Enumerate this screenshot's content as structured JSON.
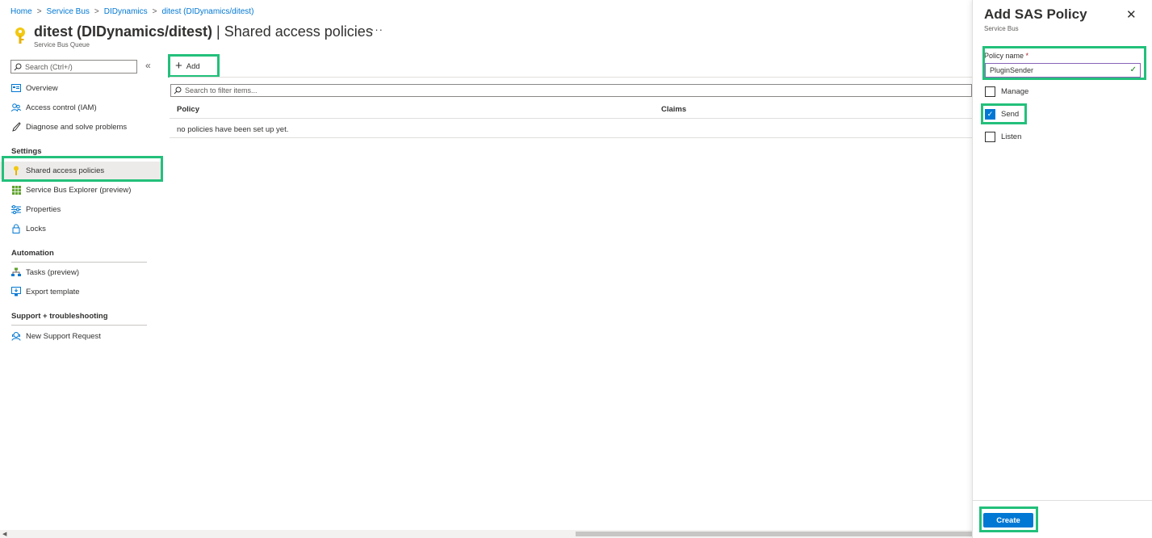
{
  "breadcrumb": {
    "items": [
      "Home",
      "Service Bus",
      "DIDynamics",
      "ditest (DIDynamics/ditest)"
    ],
    "separator": ">"
  },
  "header": {
    "title_bold": "ditest (DIDynamics/ditest)",
    "title_rest": " | Shared access policies",
    "more": "···",
    "subtitle": "Service Bus Queue",
    "icon": "key-icon",
    "icon_color": "#f2c811"
  },
  "sidebar": {
    "search_placeholder": "Search (Ctrl+/)",
    "collapse": "«",
    "items": [
      {
        "label": "Overview",
        "icon": "overview-icon"
      },
      {
        "label": "Access control (IAM)",
        "icon": "people-icon"
      },
      {
        "label": "Diagnose and solve problems",
        "icon": "wrench-icon"
      }
    ],
    "settings_title": "Settings",
    "settings_items": [
      {
        "label": "Shared access policies",
        "icon": "key-icon",
        "selected": true
      },
      {
        "label": "Service Bus Explorer (preview)",
        "icon": "grid-icon"
      },
      {
        "label": "Properties",
        "icon": "sliders-icon"
      },
      {
        "label": "Locks",
        "icon": "lock-icon"
      }
    ],
    "automation_title": "Automation",
    "automation_items": [
      {
        "label": "Tasks (preview)",
        "icon": "tasks-icon"
      },
      {
        "label": "Export template",
        "icon": "export-icon"
      }
    ],
    "support_title": "Support + troubleshooting",
    "support_items": [
      {
        "label": "New Support Request",
        "icon": "support-icon"
      }
    ]
  },
  "toolbar": {
    "add_label": "Add"
  },
  "filter": {
    "placeholder": "Search to filter items..."
  },
  "table": {
    "columns": [
      "Policy",
      "Claims"
    ],
    "empty_message": "no policies have been set up yet."
  },
  "panel": {
    "title": "Add SAS Policy",
    "subtitle": "Service Bus",
    "close": "✕",
    "policy_name_label": "Policy name",
    "required_mark": "*",
    "policy_name_value": "PluginSender",
    "checkboxes": [
      {
        "label": "Manage",
        "checked": false
      },
      {
        "label": "Send",
        "checked": true
      },
      {
        "label": "Listen",
        "checked": false
      }
    ],
    "create_label": "Create"
  },
  "colors": {
    "accent": "#0078d4",
    "highlight": "#23c07b"
  }
}
